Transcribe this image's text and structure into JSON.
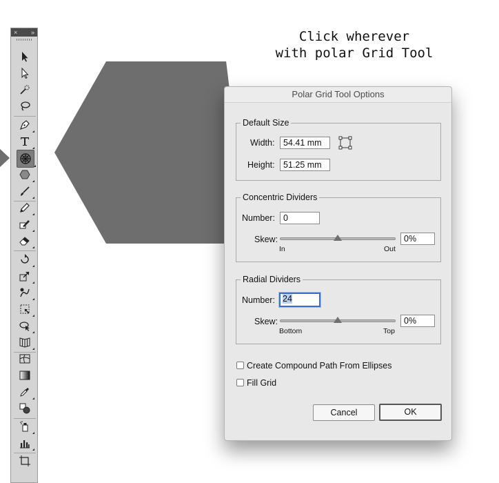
{
  "instruction": {
    "line1": "Click wherever",
    "line2": "with polar Grid Tool"
  },
  "toolbar": {
    "close_glyph": "×",
    "collapse_glyph": "»",
    "tools": [
      {
        "name": "selection-tool",
        "icon": "arrow-icon"
      },
      {
        "name": "direct-selection-tool",
        "icon": "hollow-arrow-icon"
      },
      {
        "name": "magic-wand-tool",
        "icon": "magic-wand-icon"
      },
      {
        "name": "lasso-tool",
        "icon": "lasso-icon"
      },
      {
        "name": "pen-tool",
        "icon": "pen-icon"
      },
      {
        "name": "type-tool",
        "icon": "type-icon"
      },
      {
        "name": "polar-grid-tool",
        "icon": "polar-grid-icon",
        "active": true
      },
      {
        "name": "polygon-tool",
        "icon": "polygon-icon"
      },
      {
        "name": "paintbrush-tool",
        "icon": "brush-icon"
      },
      {
        "name": "pencil-tool",
        "icon": "pencil-icon"
      },
      {
        "name": "shaper-tool",
        "icon": "shaper-icon"
      },
      {
        "name": "eraser-tool",
        "icon": "eraser-icon"
      },
      {
        "name": "rotate-tool",
        "icon": "rotate-icon"
      },
      {
        "name": "scale-tool",
        "icon": "scale-icon"
      },
      {
        "name": "warp-tool",
        "icon": "warp-icon"
      },
      {
        "name": "free-transform-tool",
        "icon": "free-transform-icon"
      },
      {
        "name": "shape-builder-tool",
        "icon": "shape-builder-icon"
      },
      {
        "name": "perspective-grid-tool",
        "icon": "perspective-grid-icon"
      },
      {
        "name": "mesh-tool",
        "icon": "mesh-icon"
      },
      {
        "name": "gradient-tool",
        "icon": "gradient-icon"
      },
      {
        "name": "eyedropper-tool",
        "icon": "eyedropper-icon"
      },
      {
        "name": "blend-tool",
        "icon": "blend-icon"
      },
      {
        "name": "symbol-sprayer-tool",
        "icon": "symbol-sprayer-icon"
      },
      {
        "name": "column-graph-tool",
        "icon": "graph-icon"
      },
      {
        "name": "artboard-tool",
        "icon": "artboard-icon"
      }
    ]
  },
  "dialog": {
    "title": "Polar Grid Tool Options",
    "default_size": {
      "legend": "Default Size",
      "width_label": "Width:",
      "width_value": "54.41 mm",
      "height_label": "Height:",
      "height_value": "51.25 mm"
    },
    "concentric": {
      "legend": "Concentric Dividers",
      "number_label": "Number:",
      "number_value": "0",
      "skew_label": "Skew:",
      "skew_value": "0%",
      "slider_left": "In",
      "slider_right": "Out",
      "slider_level": 0.5
    },
    "radial": {
      "legend": "Radial Dividers",
      "number_label": "Number:",
      "number_value": "24",
      "skew_label": "Skew:",
      "skew_value": "0%",
      "slider_left": "Bottom",
      "slider_right": "Top",
      "slider_level": 0.5
    },
    "compound_path": {
      "label": "Create Compound Path From Ellipses",
      "checked": false
    },
    "fill_grid": {
      "label": "Fill Grid",
      "checked": false
    },
    "cancel_label": "Cancel",
    "ok_label": "OK"
  },
  "colors": {
    "shape_fill": "#6e6e6e",
    "focus_ring": "#3b6fc7",
    "dialog_bg": "#e8e8e8"
  }
}
